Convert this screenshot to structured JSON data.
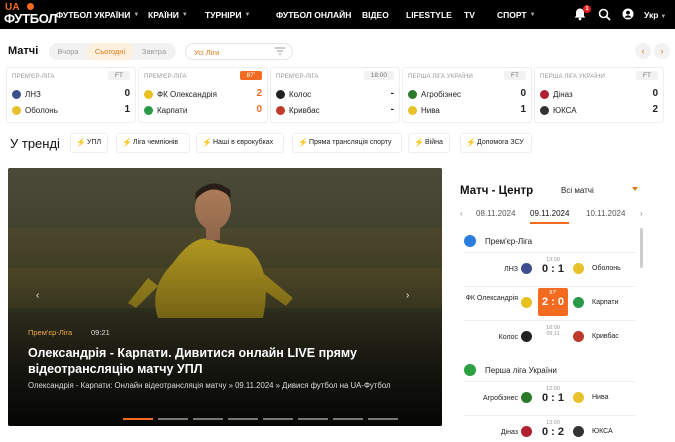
{
  "logo": {
    "ua": "UA",
    "fb": "ФУТБОЛ"
  },
  "nav": [
    {
      "label": "ФУТБОЛ УКРАЇНИ",
      "caret": true
    },
    {
      "label": "КРАЇНИ",
      "caret": true
    },
    {
      "label": "ТУРНІРИ",
      "caret": true
    },
    {
      "label": "ФУТБОЛ ОНЛАЙН",
      "caret": false
    },
    {
      "label": "ВІДЕО",
      "caret": false
    },
    {
      "label": "LIFESTYLE",
      "caret": false
    },
    {
      "label": "TV",
      "caret": false
    },
    {
      "label": "СПОРТ",
      "caret": true
    }
  ],
  "notifications": {
    "count": "1"
  },
  "lang": {
    "label": "Укр"
  },
  "matches": {
    "title": "Матчі",
    "tabs": [
      "Вчора",
      "Сьогодні",
      "Завтра"
    ],
    "active_tab": "Сьогодні",
    "league_select": "Усі Ліги",
    "cards": [
      {
        "league": "ПРЕМ'ЄР-ЛІГА",
        "status": "FT",
        "live": false,
        "home": "ЛНЗ",
        "home_score": "0",
        "away": "Оболонь",
        "away_score": "1",
        "home_color": "#3d4e8f",
        "away_color": "#e8c22b"
      },
      {
        "league": "ПРЕМ'ЄР-ЛІГА",
        "status": "87'",
        "live": true,
        "home": "ФК Олександрія",
        "home_score": "2",
        "away": "Карпати",
        "away_score": "0",
        "home_color": "#e6c120",
        "away_color": "#2a9a4a"
      },
      {
        "league": "ПРЕМ'ЄР-ЛІГА",
        "status": "18:00",
        "live": false,
        "home": "Колос",
        "home_score": "-",
        "away": "Кривбас",
        "away_score": "-",
        "home_color": "#222222",
        "away_color": "#c03a2b"
      },
      {
        "league": "ПЕРША ЛІГА УКРАЇНИ",
        "status": "FT",
        "live": false,
        "home": "Агробізнес",
        "home_score": "0",
        "away": "Нива",
        "away_score": "1",
        "home_color": "#2a7a2a",
        "away_color": "#e8c22b"
      },
      {
        "league": "ПЕРША ЛІГА УКРАЇНИ",
        "status": "FT",
        "live": false,
        "home": "Діназ",
        "home_score": "0",
        "away": "ЮКСА",
        "away_score": "2",
        "home_color": "#b02030",
        "away_color": "#333333"
      }
    ]
  },
  "trends": {
    "title": "У тренді",
    "chips": [
      "УПЛ",
      "Ліга чемпіонів",
      "Наші в єврокубках",
      "Пряма трансляція спорту",
      "Війна",
      "Допомога ЗСУ"
    ]
  },
  "hero": {
    "league": "Прем'єр-Ліга",
    "time": "09:21",
    "title": "Олександрія - Карпати. Дивитися онлайн LIVE пряму відеотрансляцію матчу УПЛ",
    "desc": "Олександрія - Карпати: Онлайн відеотрансляція матчу » 09.11.2024 » Дивися футбол на UA-Футбол",
    "slides": 8,
    "active_slide": 0
  },
  "match_center": {
    "title": "Матч - Центр",
    "filter": "Всі матчі",
    "dates": [
      "08.11.2024",
      "09.11.2024",
      "10.11.2024"
    ],
    "active_date": "09.11.2024",
    "leagues": [
      {
        "name": "Прем'єр-Ліга",
        "icon_color": "#2b7de0",
        "matches": [
          {
            "home": "ЛНЗ",
            "away": "Оболонь",
            "time": "13:00",
            "score": "0 : 1",
            "status": "",
            "live": false,
            "home_color": "#3d4e8f",
            "away_color": "#e8c22b"
          },
          {
            "home": "ФК Олександрія",
            "away": "Карпати",
            "time": "87'",
            "score": "2 : 0",
            "status": "",
            "live": true,
            "home_color": "#e6c120",
            "away_color": "#2a9a4a"
          },
          {
            "home": "Колос",
            "away": "Кривбас",
            "time": "18:00",
            "score": "",
            "status": "09.11",
            "live": false,
            "home_color": "#222222",
            "away_color": "#c03a2b"
          }
        ]
      },
      {
        "name": "Перша ліга України",
        "icon_color": "#2aa040",
        "matches": [
          {
            "home": "Агробізнес",
            "away": "Нива",
            "time": "12:00",
            "score": "0 : 1",
            "status": "",
            "live": false,
            "home_color": "#2a7a2a",
            "away_color": "#e8c22b"
          },
          {
            "home": "Діназ",
            "away": "ЮКСА",
            "time": "13:00",
            "score": "0 : 2",
            "status": "",
            "live": false,
            "home_color": "#b02030",
            "away_color": "#333333"
          }
        ]
      }
    ]
  }
}
